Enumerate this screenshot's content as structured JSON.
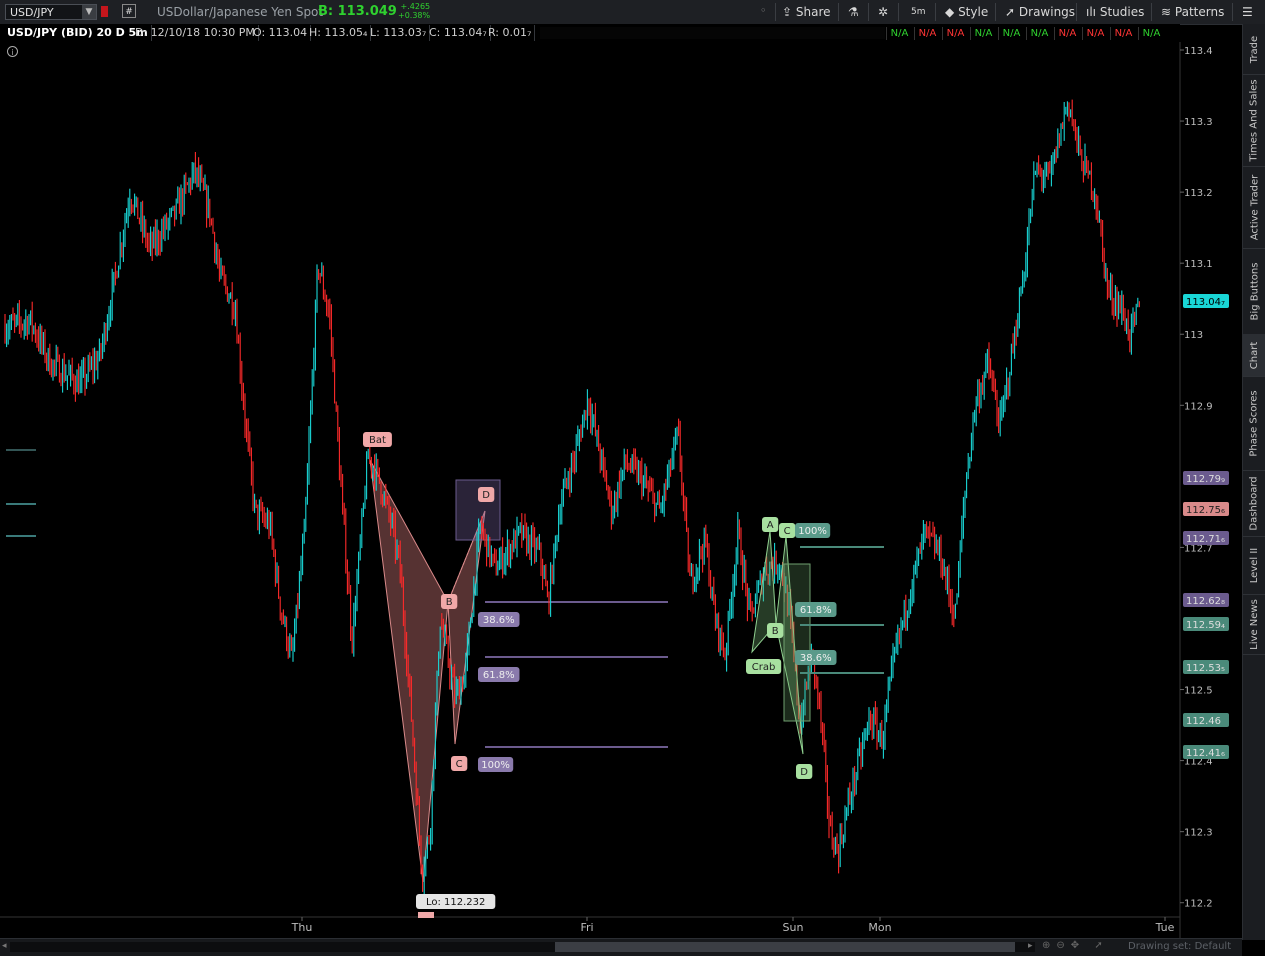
{
  "header": {
    "symbol": "USD/JPY",
    "hash": "#",
    "description": "USDollar/Japanese Yen Spot",
    "bid": "B: 113.049",
    "change": "+.4265",
    "change_pct": "+0.38%",
    "tools": [
      {
        "label": "Share",
        "icon": "share-icon"
      },
      {
        "label": "",
        "icon": "flask-icon"
      },
      {
        "label": "",
        "icon": "gear-icon"
      },
      {
        "label": "5m",
        "icon": ""
      },
      {
        "label": "Style",
        "icon": "style-icon"
      },
      {
        "label": "Drawings",
        "icon": "cursor-icon"
      },
      {
        "label": "Studies",
        "icon": "studies-icon"
      },
      {
        "label": "Patterns",
        "icon": "patterns-icon"
      }
    ]
  },
  "info": {
    "title": "USD/JPY (BID) 20 D 5m",
    "date": "D: 12/10/18 10:30 PM",
    "open": "O: 113.04",
    "high": "H: 113.05₄",
    "low": "L: 113.03₇",
    "close": "C: 113.04₇",
    "range": "R: 0.01₇",
    "na_values": [
      "N/A",
      "N/A",
      "N/A",
      "N/A",
      "N/A",
      "N/A",
      "N/A",
      "N/A",
      "N/A",
      "N/A"
    ],
    "na_colors": [
      "#2fd12f",
      "#ff3535",
      "#ff3535",
      "#2fd12f",
      "#2fd12f",
      "#2fd12f",
      "#ff3535",
      "#ff3535",
      "#ff3535",
      "#2fd12f"
    ]
  },
  "right_tabs": [
    "Trade",
    "Times And Sales",
    "Active Trader",
    "Big Buttons",
    "Chart",
    "Phase Scores",
    "Dashboard",
    "Level II",
    "Live News"
  ],
  "footer": {
    "drawing_set": "Drawing set: Default"
  },
  "chart_data": {
    "type": "candlestick",
    "y_axis": {
      "ticks": [
        113.4,
        113.3,
        113.2,
        113.1,
        113.0,
        112.9,
        112.7,
        112.5,
        112.4,
        112.3,
        112.2
      ],
      "ylim": [
        112.19,
        113.42
      ]
    },
    "x_axis": {
      "labels": [
        "Thu",
        "Fri",
        "Sun",
        "Mon",
        "Tue"
      ]
    },
    "last_price": "113.04₇",
    "colors": {
      "up": "#19d6d6",
      "down": "#ff2a2a",
      "last_price": "#19d6d6"
    },
    "price_markers": [
      {
        "label": "113.04₇",
        "value": 113.047,
        "color": "#19d6d6",
        "text_color": "#000"
      },
      {
        "label": "112.79₉",
        "value": 112.799,
        "color": "#6b5b8e",
        "text_color": "#ddd"
      },
      {
        "label": "112.75₆",
        "value": 112.756,
        "color": "#d98a8a",
        "text_color": "#222"
      },
      {
        "label": "112.71₆",
        "value": 112.716,
        "color": "#6b5b8e",
        "text_color": "#ddd"
      },
      {
        "label": "112.62₈",
        "value": 112.628,
        "color": "#6b5b8e",
        "text_color": "#ddd"
      },
      {
        "label": "112.59₄",
        "value": 112.594,
        "color": "#4a8a7a",
        "text_color": "#ddd"
      },
      {
        "label": "112.53₅",
        "value": 112.535,
        "color": "#4a8a7a",
        "text_color": "#ddd"
      },
      {
        "label": "112.46",
        "value": 112.46,
        "color": "#4a8a7a",
        "text_color": "#ddd"
      },
      {
        "label": "112.41₆",
        "value": 112.416,
        "color": "#4a8a7a",
        "text_color": "#ddd"
      }
    ],
    "annotations": {
      "low_label": "Lo: 112.232",
      "bat": {
        "name": "Bat",
        "points": [
          "D",
          "B",
          "C"
        ],
        "fib": [
          "38.6%",
          "61.8%",
          "100%"
        ]
      },
      "crab": {
        "name": "Crab",
        "points": [
          "A",
          "C",
          "B",
          "D"
        ],
        "fib": [
          "100%",
          "61.8%",
          "38.6%"
        ]
      }
    }
  }
}
